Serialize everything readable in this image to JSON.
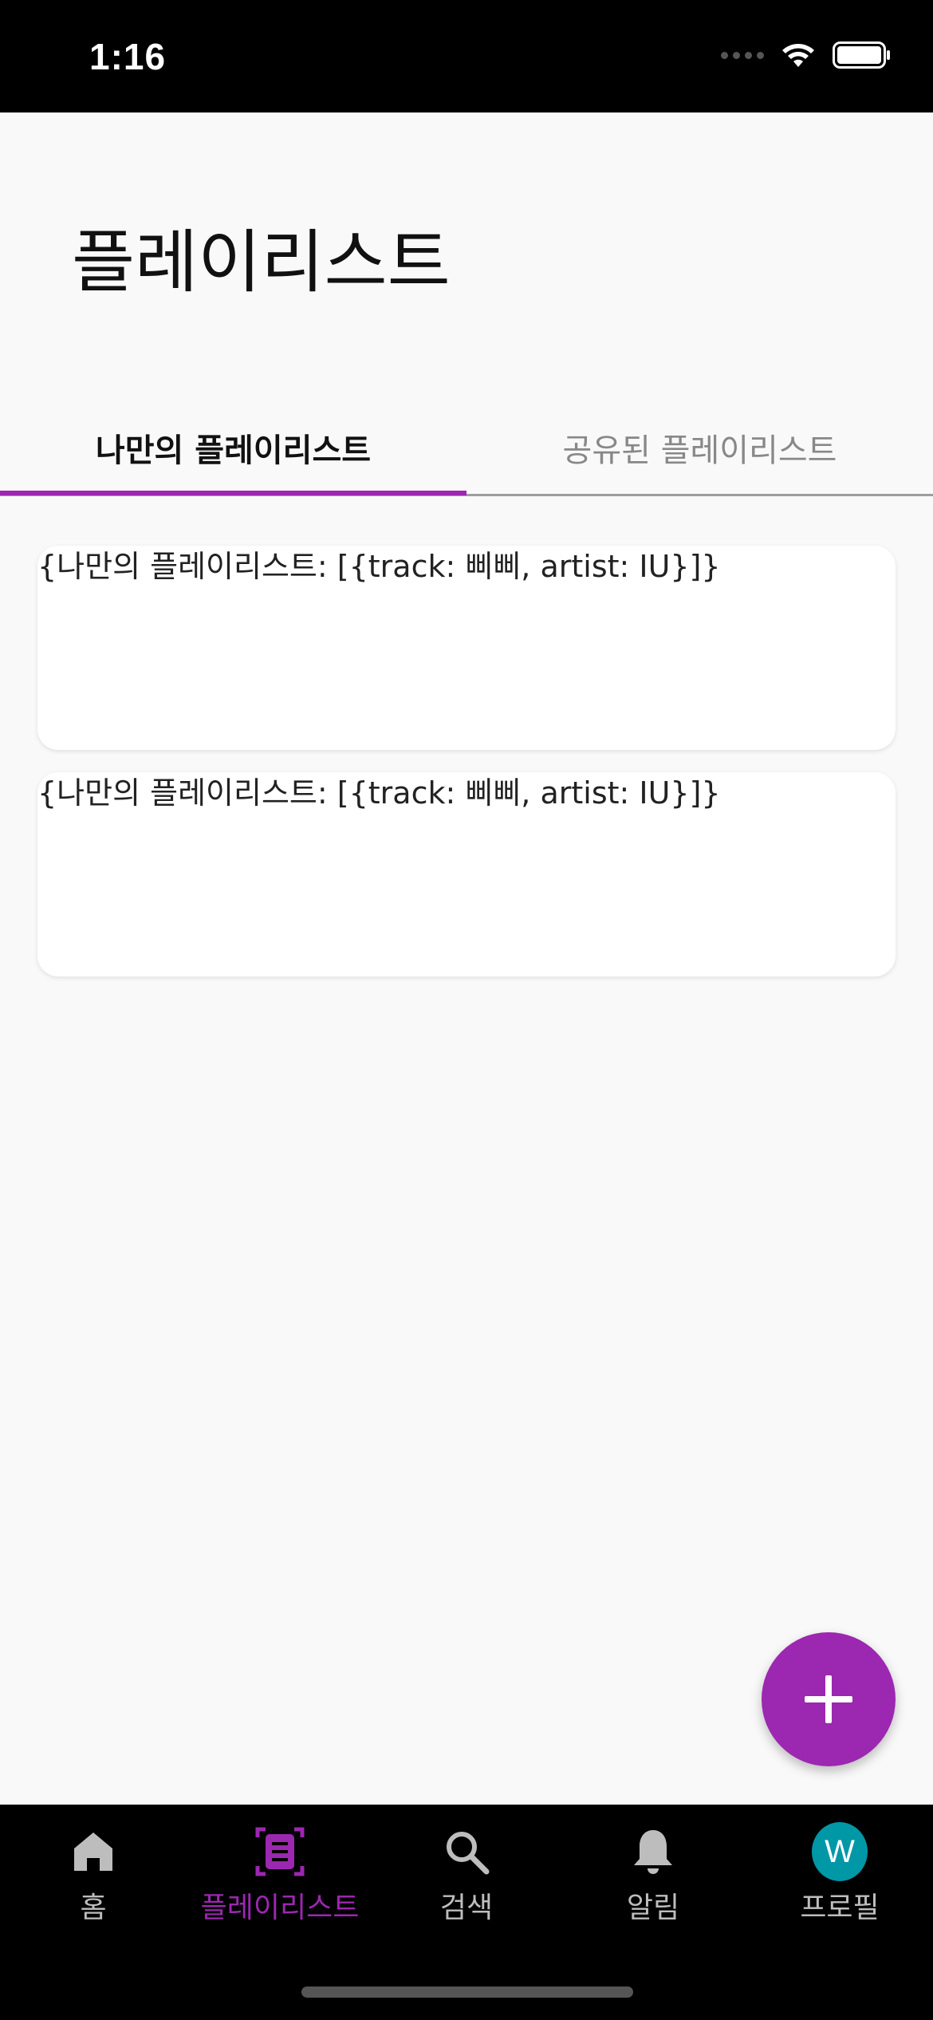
{
  "status_bar": {
    "time": "1:16"
  },
  "page": {
    "title": "플레이리스트"
  },
  "tabs": [
    {
      "label": "나만의 플레이리스트",
      "selected": true
    },
    {
      "label": "공유된 플레이리스트",
      "selected": false
    }
  ],
  "cards": [
    {
      "text": "{나만의 플레이리스트: [{track: 삐삐, artist: IU}]}"
    },
    {
      "text": "{나만의 플레이리스트: [{track: 삐삐, artist: IU}]}"
    }
  ],
  "fab": {
    "icon": "plus-icon"
  },
  "bottom_nav": {
    "items": [
      {
        "label": "홈",
        "icon": "home-icon"
      },
      {
        "label": "플레이리스트",
        "icon": "playlist-icon",
        "active": true
      },
      {
        "label": "검색",
        "icon": "search-icon"
      },
      {
        "label": "알림",
        "icon": "bell-icon"
      },
      {
        "label": "프로필",
        "icon": "avatar",
        "avatar_letter": "W"
      }
    ]
  },
  "colors": {
    "accent": "#9c27b0",
    "avatar_bg": "#0097a7",
    "background": "#f9f9f9"
  }
}
